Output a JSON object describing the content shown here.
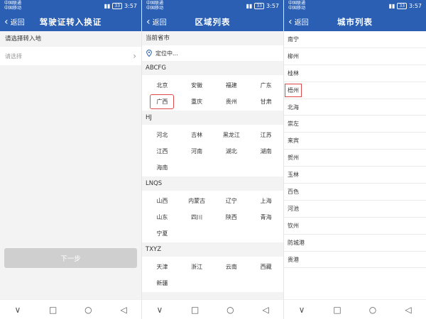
{
  "status": {
    "carrier1": "中国联通",
    "carrier2": "中国移动",
    "time": "3:57",
    "battery": "33"
  },
  "nav": {
    "back_label": "返回"
  },
  "screen1": {
    "title": "驾驶证转入换证",
    "select_label": "请选择转入地",
    "select_placeholder": "请选择",
    "next_button": "下一步"
  },
  "screen2": {
    "title": "区域列表",
    "current_label": "当前省市",
    "locating": "定位中...",
    "groups": [
      {
        "header": "ABCFG",
        "items": [
          "北京",
          "安徽",
          "福建",
          "广东",
          "广西",
          "重庆",
          "贵州",
          "甘肃"
        ]
      },
      {
        "header": "HJ",
        "items": [
          "河北",
          "吉林",
          "黑龙江",
          "江苏",
          "江西",
          "河南",
          "湖北",
          "湖南",
          "海南"
        ]
      },
      {
        "header": "LNQS",
        "items": [
          "山西",
          "内蒙古",
          "辽宁",
          "上海",
          "山东",
          "四川",
          "陕西",
          "青海",
          "宁夏"
        ]
      },
      {
        "header": "TXYZ",
        "items": [
          "天津",
          "浙江",
          "云南",
          "西藏",
          "新疆"
        ]
      }
    ],
    "selected": "广西"
  },
  "screen3": {
    "title": "城市列表",
    "cities": [
      "南宁",
      "柳州",
      "桂林",
      "梧州",
      "北海",
      "崇左",
      "来宾",
      "贺州",
      "玉林",
      "百色",
      "河池",
      "钦州",
      "防城港",
      "贵港"
    ],
    "selected": "梧州"
  },
  "bottom_nav": {
    "back": "◁",
    "home": "○",
    "recent": "□",
    "down": "∨"
  }
}
